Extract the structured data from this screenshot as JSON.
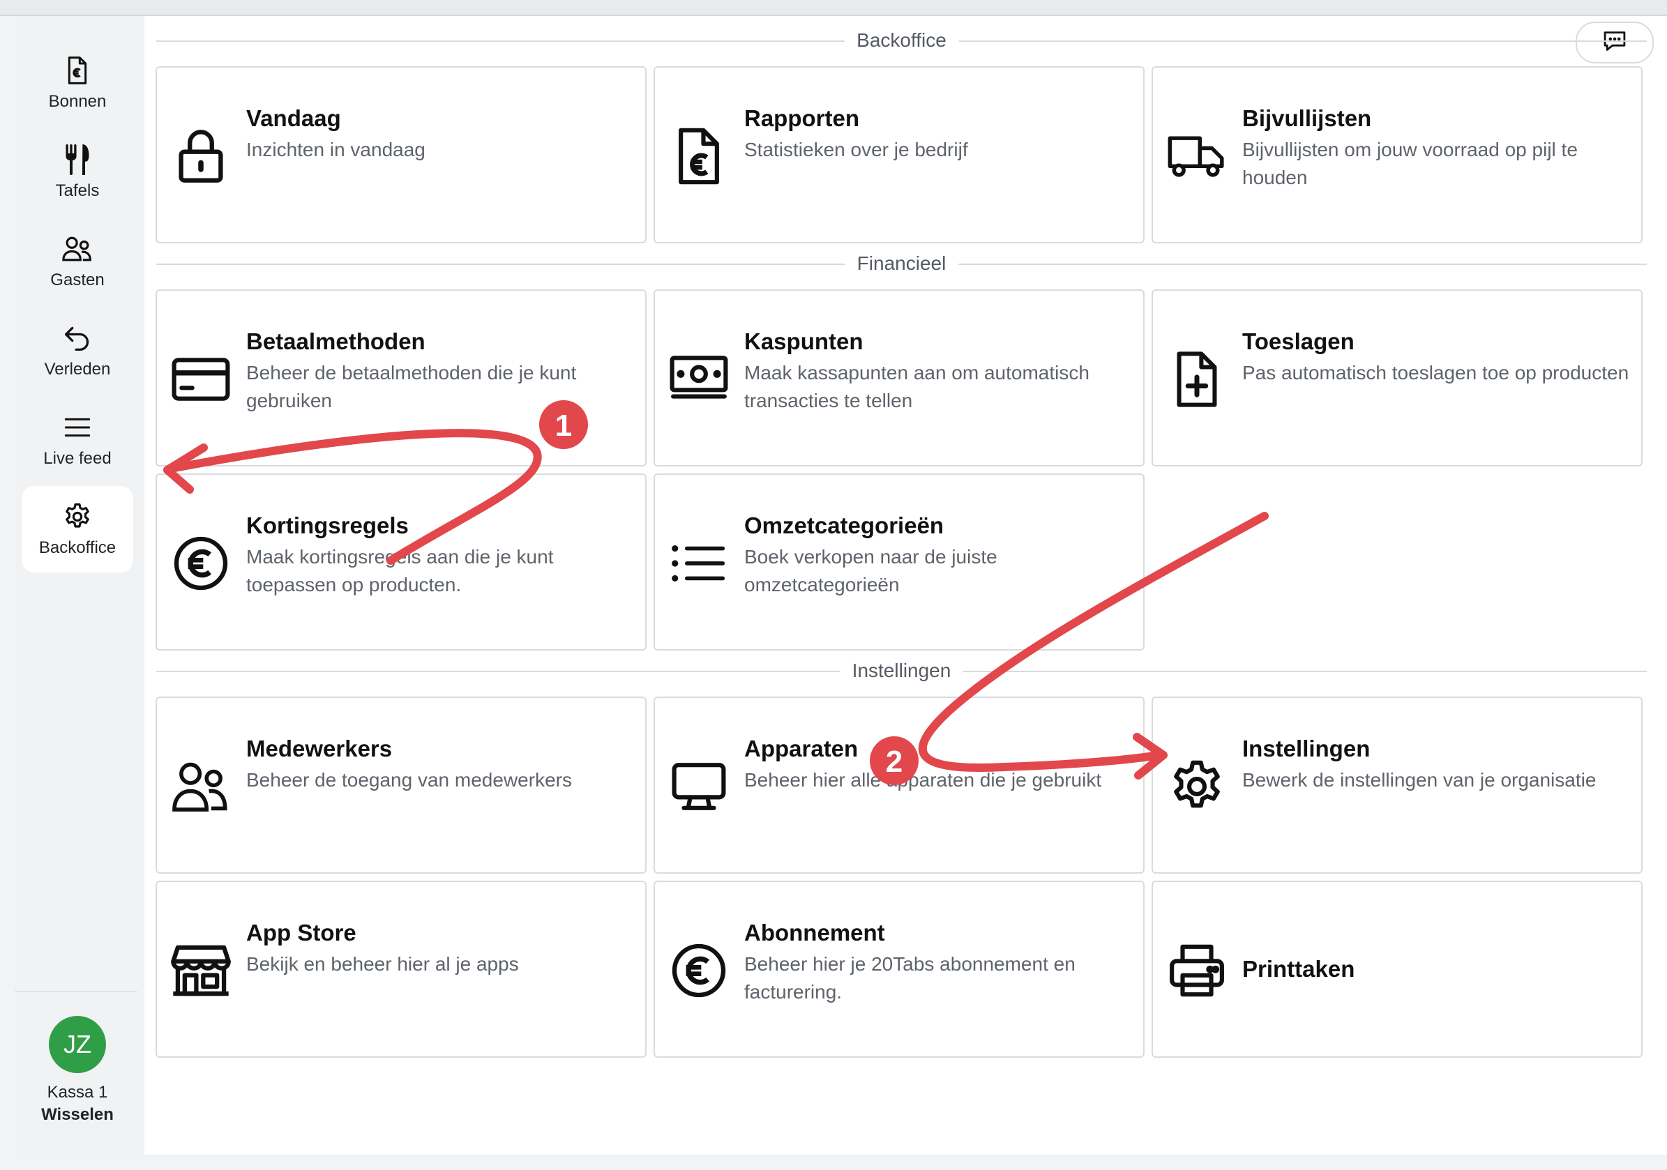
{
  "sidebar": {
    "items": [
      {
        "label": "Bonnen",
        "icon": "receipt-euro-icon"
      },
      {
        "label": "Tafels",
        "icon": "fork-knife-icon"
      },
      {
        "label": "Gasten",
        "icon": "users-icon"
      },
      {
        "label": "Verleden",
        "icon": "undo-arrow-icon"
      },
      {
        "label": "Live feed",
        "icon": "menu-lines-icon"
      },
      {
        "label": "Backoffice",
        "icon": "gear-icon",
        "active": true
      }
    ],
    "user": {
      "initials": "JZ",
      "device": "Kassa 1",
      "switch_label": "Wisselen"
    }
  },
  "sections": [
    {
      "title": "Backoffice",
      "cards": [
        {
          "title": "Vandaag",
          "description": "Inzichten in vandaag",
          "icon": "lock-icon"
        },
        {
          "title": "Rapporten",
          "description": "Statistieken over je bedrijf",
          "icon": "euro-document-icon"
        },
        {
          "title": "Bijvullijsten",
          "description": "Bijvullijsten om jouw voorraad op pijl te houden",
          "icon": "truck-icon"
        }
      ]
    },
    {
      "title": "Financieel",
      "cards": [
        {
          "title": "Betaalmethoden",
          "description": "Beheer de betaalmethoden die je kunt gebruiken",
          "icon": "credit-card-icon"
        },
        {
          "title": "Kaspunten",
          "description": "Maak kassapunten aan om automatisch transacties te tellen",
          "icon": "cash-icon"
        },
        {
          "title": "Toeslagen",
          "description": "Pas automatisch toeslagen toe op producten",
          "icon": "document-plus-icon"
        },
        {
          "title": "Kortingsregels",
          "description": "Maak kortingsregels aan die je kunt toepassen op producten.",
          "icon": "euro-circle-icon"
        },
        {
          "title": "Omzetcategorieën",
          "description": "Boek verkopen naar de juiste omzetcategorieën",
          "icon": "list-icon"
        }
      ]
    },
    {
      "title": "Instellingen",
      "cards": [
        {
          "title": "Medewerkers",
          "description": "Beheer de toegang van medewerkers",
          "icon": "users-icon"
        },
        {
          "title": "Apparaten",
          "description": "Beheer hier alle apparaten die je gebruikt",
          "icon": "monitor-icon"
        },
        {
          "title": "Instellingen",
          "description": "Bewerk de instellingen van je organisatie",
          "icon": "gear-icon"
        },
        {
          "title": "App Store",
          "description": "Bekijk en beheer hier al je apps",
          "icon": "store-icon"
        },
        {
          "title": "Abonnement",
          "description": "Beheer hier je 20Tabs abonnement en facturering.",
          "icon": "euro-circle-icon"
        },
        {
          "title": "Printtaken",
          "icon": "printer-icon"
        }
      ]
    }
  ],
  "annotations": {
    "badge_1": "1",
    "badge_2": "2",
    "arrow_color": "#e2474c"
  },
  "colors": {
    "accent_green": "#2f9e47",
    "border": "#d9dbde",
    "muted_text": "#5e636b"
  }
}
